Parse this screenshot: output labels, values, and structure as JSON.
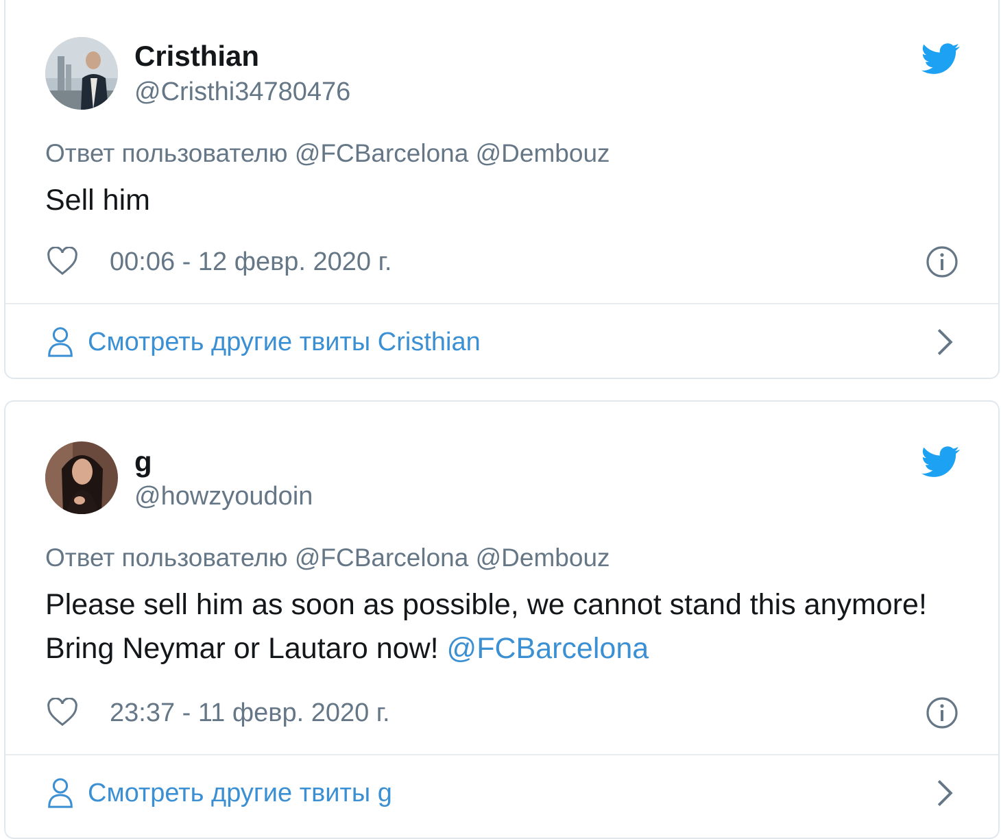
{
  "tweets": [
    {
      "display_name": "Cristhian",
      "handle": "@Cristhi34780476",
      "reply_to": "Ответ пользователю @FCBarcelona @Dembouz",
      "text": "Sell him",
      "text_mention": "",
      "timestamp": "00:06 - 12 февр. 2020 г.",
      "more_label": "Смотреть другие твиты Cristhian"
    },
    {
      "display_name": "g",
      "handle": "@howzyoudoin",
      "reply_to": "Ответ пользователю @FCBarcelona @Dembouz",
      "text": "Please sell him as soon as possible, we cannot stand this anymore! Bring Neymar or Lautaro now! ",
      "text_mention": "@FCBarcelona",
      "timestamp": "23:37 - 11 февр. 2020 г.",
      "more_label": "Смотреть другие твиты g"
    }
  ],
  "icons": {
    "bird": "twitter-bird-icon",
    "like": "heart-icon",
    "info": "info-icon",
    "profile": "person-icon",
    "next": "chevron-right-icon"
  },
  "colors": {
    "twitter_blue": "#1da1f2",
    "link_blue": "#3b8fd3",
    "secondary_text": "#657786",
    "primary_text": "#14171a",
    "border": "#e1e8ed"
  }
}
